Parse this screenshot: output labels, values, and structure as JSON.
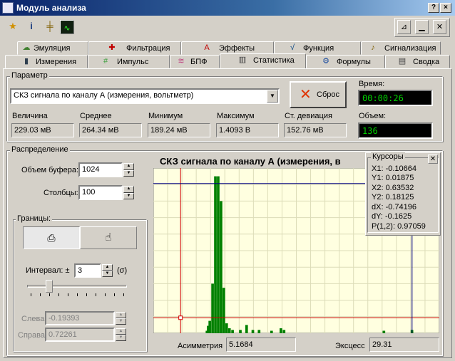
{
  "window": {
    "title": "Модуль анализа",
    "help_btn": "?",
    "close_btn": "×"
  },
  "tabs_row1": [
    {
      "label": "Эмуляция",
      "icon": "☁"
    },
    {
      "label": "Фильтрация",
      "icon": "✚"
    },
    {
      "label": "Эффекты",
      "icon": "A"
    },
    {
      "label": "Функция",
      "icon": "√"
    },
    {
      "label": "Сигнализация",
      "icon": "♪"
    }
  ],
  "tabs_row2": [
    {
      "label": "Измерения",
      "icon": "▮"
    },
    {
      "label": "Импульс",
      "icon": "#"
    },
    {
      "label": "БПФ",
      "icon": "≋"
    },
    {
      "label": "Статистика",
      "icon": "▥"
    },
    {
      "label": "Формулы",
      "icon": "⚙"
    },
    {
      "label": "Сводка",
      "icon": "▤"
    }
  ],
  "param": {
    "title": "Параметр",
    "selected": "СКЗ сигнала по каналу А (измерения, вольтметр)",
    "reset_label": "Сброс",
    "time_label": "Время:",
    "time_value": "00:00:26",
    "volume_label": "Объем:",
    "volume_value": "136",
    "stats": [
      {
        "label": "Величина",
        "value": "229.03 мВ"
      },
      {
        "label": "Среднее",
        "value": "264.34 мВ"
      },
      {
        "label": "Минимум",
        "value": "189.24 мВ"
      },
      {
        "label": "Максимум",
        "value": "1.4093 В"
      },
      {
        "label": "Ст. девиация",
        "value": "152.76 мВ"
      }
    ]
  },
  "dist": {
    "title": "Распределение",
    "buffer_label": "Объем буфера:",
    "buffer_value": "1024",
    "columns_label": "Столбцы:",
    "columns_value": "100",
    "bounds_title": "Границы:",
    "interval_label": "Интервал: ±",
    "interval_value": "3",
    "sigma_label": "(σ)",
    "interval_slider": 0.2,
    "left_label": "Слева",
    "left_value": "-0.19393",
    "right_label": "Справа",
    "right_value": "0.72261",
    "asym_label": "Асимметрия",
    "asym_value": "5.1684",
    "excess_label": "Эксцесс",
    "excess_value": "29.31"
  },
  "cursors": {
    "title": "Курсоры",
    "lines": [
      "X1: -0.10664",
      "Y1: 0.01875",
      "X2: 0.63532",
      "Y2: 0.18125",
      "dX: -0.74196",
      "dY: -0.1625",
      "P(1,2): 0.97059"
    ]
  },
  "colors": {
    "bar": "#008000",
    "plot_bg": "#ffffe0",
    "cursor_red": "#d00000",
    "cursor_blue": "#000080"
  },
  "chart_data": {
    "type": "bar",
    "title": "СКЗ сигнала по каналу А (измерения, в",
    "x_range": [
      -0.19393,
      0.72261
    ],
    "y_range": [
      0,
      0.2
    ],
    "bins": [
      {
        "x": -0.022,
        "v": 0.003
      },
      {
        "x": -0.018,
        "v": 0.009
      },
      {
        "x": -0.013,
        "v": 0.015
      },
      {
        "x": -0.004,
        "v": 0.06
      },
      {
        "x": 0.005,
        "v": 0.19
      },
      {
        "x": 0.014,
        "v": 0.19
      },
      {
        "x": 0.023,
        "v": 0.16
      },
      {
        "x": 0.032,
        "v": 0.055
      },
      {
        "x": 0.041,
        "v": 0.012
      },
      {
        "x": 0.05,
        "v": 0.006
      },
      {
        "x": 0.06,
        "v": 0.004
      },
      {
        "x": 0.085,
        "v": 0.004
      },
      {
        "x": 0.105,
        "v": 0.01
      },
      {
        "x": 0.125,
        "v": 0.004
      },
      {
        "x": 0.145,
        "v": 0.004
      },
      {
        "x": 0.185,
        "v": 0.003
      },
      {
        "x": 0.215,
        "v": 0.006
      },
      {
        "x": 0.225,
        "v": 0.004
      },
      {
        "x": 0.545,
        "v": 0.003
      },
      {
        "x": 0.635,
        "v": 0.004
      }
    ],
    "cursor_x1": -0.10664,
    "cursor_y1": 0.01875,
    "cursor_x2": 0.63532,
    "cursor_y2": 0.18125
  }
}
